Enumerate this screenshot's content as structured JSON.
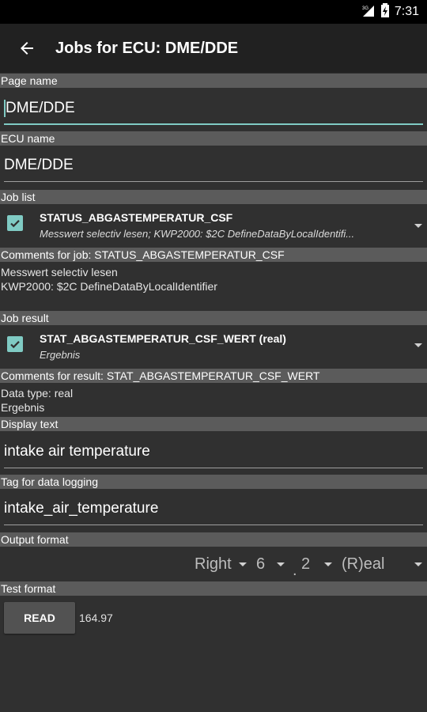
{
  "status_bar": {
    "time": "7:31",
    "network": "3G"
  },
  "appbar": {
    "title": "Jobs for ECU: DME/DDE"
  },
  "page_name": {
    "label": "Page name",
    "value": "DME/DDE"
  },
  "ecu_name": {
    "label": "ECU name",
    "value": "DME/DDE"
  },
  "job_list": {
    "label": "Job list",
    "selected_title": "STATUS_ABGASTEMPERATUR_CSF",
    "selected_sub": "Messwert selectiv lesen; KWP2000: $2C DefineDataByLocalIdentifi...",
    "checked": true
  },
  "job_comments": {
    "label": "Comments for job: STATUS_ABGASTEMPERATUR_CSF",
    "line1": "Messwert selectiv lesen",
    "line2": "KWP2000: $2C DefineDataByLocalIdentifier"
  },
  "job_result": {
    "label": "Job result",
    "selected_title": "STAT_ABGASTEMPERATUR_CSF_WERT (real)",
    "selected_sub": "Ergebnis",
    "checked": true
  },
  "result_comments": {
    "label": "Comments for result: STAT_ABGASTEMPERATUR_CSF_WERT",
    "line1": "Data type: real",
    "line2": "Ergebnis"
  },
  "display_text": {
    "label": "Display text",
    "value": "intake air temperature"
  },
  "log_tag": {
    "label": "Tag for data logging",
    "value": "intake_air_temperature"
  },
  "output_format": {
    "label": "Output format",
    "align": "Right",
    "width": "6",
    "separator": ".",
    "digits": "2",
    "type": "(R)eal"
  },
  "test_format": {
    "label": "Test format",
    "button": "READ",
    "value": "164.97"
  },
  "colors": {
    "accent": "#80cbc4",
    "background": "#303030",
    "section": "#5b5b5b"
  }
}
